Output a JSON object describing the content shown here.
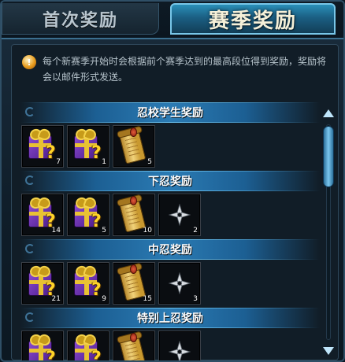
{
  "tabs": {
    "first_reward": "首次奖励",
    "season_reward": "赛季奖励"
  },
  "notice": {
    "icon": "info-icon",
    "text": "每个新赛季开始时会根据前个赛季达到的最高段位得到奖励，奖励将会以邮件形式发送。"
  },
  "sections": [
    {
      "title": "忍校学生奖励",
      "items": [
        {
          "icon": "gift-box-icon",
          "count": "7"
        },
        {
          "icon": "gift-box-icon",
          "count": "1"
        },
        {
          "icon": "scroll-icon",
          "count": "5"
        }
      ]
    },
    {
      "title": "下忍奖励",
      "items": [
        {
          "icon": "gift-box-icon",
          "count": "14"
        },
        {
          "icon": "gift-box-icon",
          "count": "5"
        },
        {
          "icon": "scroll-icon",
          "count": "10"
        },
        {
          "icon": "shuriken-icon",
          "count": "2"
        }
      ]
    },
    {
      "title": "中忍奖励",
      "items": [
        {
          "icon": "gift-box-icon",
          "count": "21"
        },
        {
          "icon": "gift-box-icon",
          "count": "9"
        },
        {
          "icon": "scroll-icon",
          "count": "15"
        },
        {
          "icon": "shuriken-icon",
          "count": "3"
        }
      ]
    },
    {
      "title": "特别上忍奖励",
      "items": [
        {
          "icon": "gift-box-icon",
          "count": ""
        },
        {
          "icon": "gift-box-icon",
          "count": ""
        },
        {
          "icon": "scroll-icon",
          "count": ""
        },
        {
          "icon": "shuriken-icon",
          "count": ""
        }
      ]
    }
  ],
  "colors": {
    "tab_active": "#2a8fb8",
    "section_bar": "#2b7bb4",
    "gift": "#8a4ad0",
    "question_mark": "#ffd32a"
  }
}
